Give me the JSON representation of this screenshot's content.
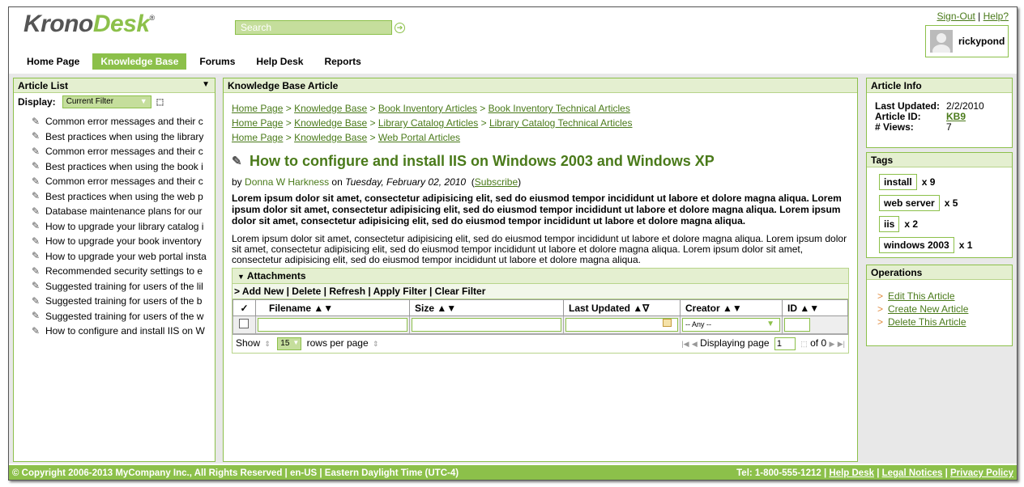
{
  "brand": {
    "part1": "Krono",
    "part2": "Desk",
    "reg": "®"
  },
  "search": {
    "placeholder": "Search"
  },
  "top_links": {
    "signout": "Sign-Out",
    "sep": "|",
    "help": "Help?"
  },
  "user": {
    "name": "rickypond"
  },
  "nav": [
    "Home Page",
    "Knowledge Base",
    "Forums",
    "Help Desk",
    "Reports"
  ],
  "nav_active": "Knowledge Base",
  "article_list": {
    "title": "Article List",
    "display_label": "Display:",
    "filter_value": "Current Filter",
    "items": [
      "Common error messages and their c",
      "Best practices when using the library",
      "Common error messages and their c",
      "Best practices when using the book i",
      "Common error messages and their c",
      "Best practices when using the web p",
      "Database maintenance plans for our",
      "How to upgrade your library catalog i",
      "How to upgrade your book inventory",
      "How to upgrade your web portal insta",
      "Recommended security settings to e",
      "Suggested training for users of the lil",
      "Suggested training for users of the b",
      "Suggested training for users of the w",
      "How to configure and install IIS on W"
    ]
  },
  "article": {
    "panel_title": "Knowledge Base Article",
    "breadcrumbs": [
      [
        "Home Page",
        "Knowledge Base",
        "Book Inventory Articles",
        "Book Inventory Technical Articles"
      ],
      [
        "Home Page",
        "Knowledge Base",
        "Library Catalog Articles",
        "Library Catalog Technical Articles"
      ],
      [
        "Home Page",
        "Knowledge Base",
        "Web Portal Articles"
      ]
    ],
    "breadcrumb_sep": ">",
    "title": "How to configure and install IIS on Windows 2003 and Windows XP",
    "by": "by",
    "author": "Donna W Harkness",
    "on": "on",
    "date": "Tuesday, February 02, 2010",
    "subscribe": "Subscribe",
    "bold_paragraph": "Lorem ipsum dolor sit amet, consectetur adipisicing elit, sed do eiusmod tempor incididunt ut labore et dolore magna aliqua. Lorem ipsum dolor sit amet, consectetur adipisicing elit, sed do eiusmod tempor incididunt ut labore et dolore magna aliqua. Lorem ipsum dolor sit amet, consectetur adipisicing elit, sed do eiusmod tempor incididunt ut labore et dolore magna aliqua.",
    "paragraph": "Lorem ipsum dolor sit amet, consectetur adipisicing elit, sed do eiusmod tempor incididunt ut labore et dolore magna aliqua. Lorem ipsum dolor sit amet, consectetur adipisicing elit, sed do eiusmod tempor incididunt ut labore et dolore magna aliqua. Lorem ipsum dolor sit amet, consectetur adipisicing elit, sed do eiusmod tempor incididunt ut labore et dolore magna aliqua."
  },
  "attachments": {
    "title": "Attachments",
    "tools_prefix": ">",
    "tools": [
      "Add New",
      "Delete",
      "Refresh",
      "Apply Filter",
      "Clear Filter"
    ],
    "check_header": "✓",
    "columns": [
      "Filename ▲▼",
      "Size ▲▼",
      "Last Updated ▲∇",
      "Creator ▲▼",
      "ID ▲▼"
    ],
    "creator_filter": "-- Any --",
    "show_label": "Show",
    "rows_value": "15",
    "rows_label": "rows per page",
    "displaying_label": "Displaying page",
    "page_value": "1",
    "of_label": "of 0"
  },
  "info": {
    "title": "Article Info",
    "last_updated_label": "Last Updated:",
    "last_updated": "2/2/2010",
    "article_id_label": "Article ID:",
    "article_id": "KB9",
    "views_label": "# Views:",
    "views": "7"
  },
  "tags": {
    "title": "Tags",
    "items": [
      {
        "name": "install",
        "count": "x 9"
      },
      {
        "name": "web server",
        "count": "x 5"
      },
      {
        "name": "iis",
        "count": "x 2"
      },
      {
        "name": "windows 2003",
        "count": "x 1"
      }
    ]
  },
  "operations": {
    "title": "Operations",
    "items": [
      "Edit This Article",
      "Create New Article",
      "Delete This Article"
    ]
  },
  "footer": {
    "left": "© Copyright 2006-2013 MyCompany Inc., All Rights Reserved | en-US | Eastern Daylight Time (UTC-4)",
    "tel": "Tel: 1-800-555-1212",
    "links": [
      "Help Desk",
      "Legal Notices",
      "Privacy Policy"
    ]
  },
  "colors": {
    "accent": "#8cc04a",
    "link": "#4a7a1a",
    "panel_head": "#e4efd0"
  }
}
